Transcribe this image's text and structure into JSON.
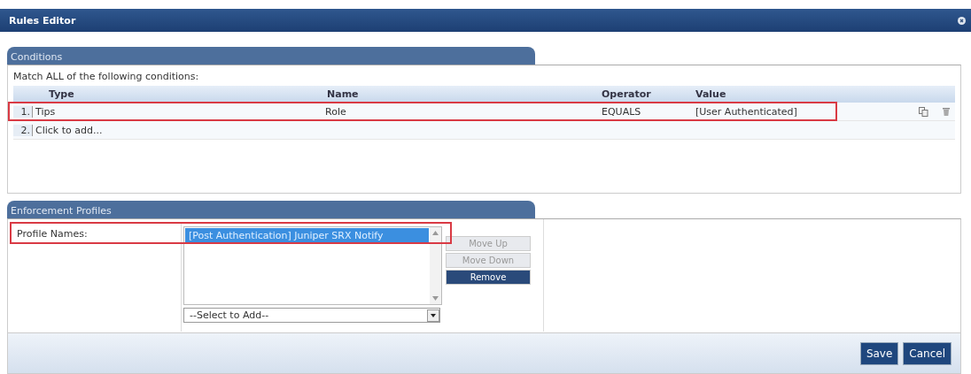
{
  "window": {
    "title": "Rules Editor"
  },
  "conditions": {
    "title": "Conditions",
    "match_text": "Match ALL of the following conditions:",
    "columns": [
      "Type",
      "Name",
      "Operator",
      "Value"
    ],
    "rows": [
      {
        "number": "1.",
        "type": "Tips",
        "name": "Role",
        "operator": "EQUALS",
        "value": "[User Authenticated]",
        "highlighted": true
      },
      {
        "number": "2.",
        "placeholder": "Click to add...",
        "highlighted": false
      }
    ]
  },
  "enforcement": {
    "title": "Enforcement Profiles",
    "label": "Profile Names:",
    "highlighted": true,
    "profiles": [
      {
        "label": "[Post Authentication] Juniper SRX Notify",
        "selected": true
      }
    ],
    "select": {
      "placeholder": "--Select to Add--"
    },
    "side_buttons": [
      {
        "label": "Move Up",
        "disabled": true
      },
      {
        "label": "Move Down",
        "disabled": true
      },
      {
        "label": "Remove",
        "disabled": false
      }
    ]
  },
  "buttons": [
    "Save",
    "Cancel"
  ]
}
